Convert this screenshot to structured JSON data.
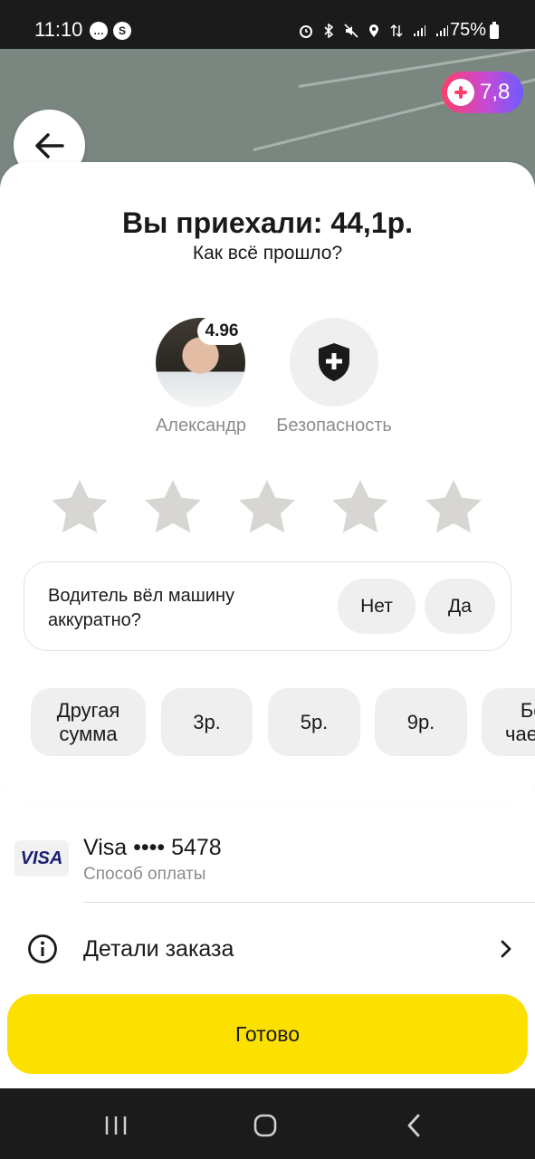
{
  "status_bar": {
    "time": "11:10",
    "notification_icons": [
      "chat-bubble-icon",
      "shazam-icon"
    ],
    "system_icons": [
      "alarm-icon",
      "bluetooth-icon",
      "mute-icon",
      "location-icon",
      "data-arrows-icon",
      "signal-icon",
      "signal-icon"
    ],
    "battery_text": "75%",
    "battery_level": 0.75
  },
  "map": {
    "plus_points": "7,8"
  },
  "trip_summary": {
    "title": "Вы приехали: 44,1р.",
    "subtitle": "Как всё прошло?"
  },
  "driver": {
    "name": "Александр",
    "rating": "4.96"
  },
  "safety": {
    "label": "Безопасность"
  },
  "stars": {
    "count": 5,
    "selected": 0
  },
  "driving_question": {
    "text": "Водитель вёл машину аккуратно?",
    "no_label": "Нет",
    "yes_label": "Да"
  },
  "tips": [
    {
      "label": "Другая сумма"
    },
    {
      "label": "3р."
    },
    {
      "label": "5р."
    },
    {
      "label": "9р."
    },
    {
      "label": "Без чаевых"
    }
  ],
  "payment": {
    "logo": "VISA",
    "card": "Visa •••• 5478",
    "label": "Способ оплаты"
  },
  "order_details": {
    "label": "Детали заказа"
  },
  "done_button": {
    "label": "Готово"
  },
  "colors": {
    "accent_yellow": "#fce000",
    "status_bar": "#1b1b1b",
    "secondary_text": "#8c8c8c",
    "chip_bg": "#efefef",
    "star_inactive": "#d8d6d2"
  }
}
